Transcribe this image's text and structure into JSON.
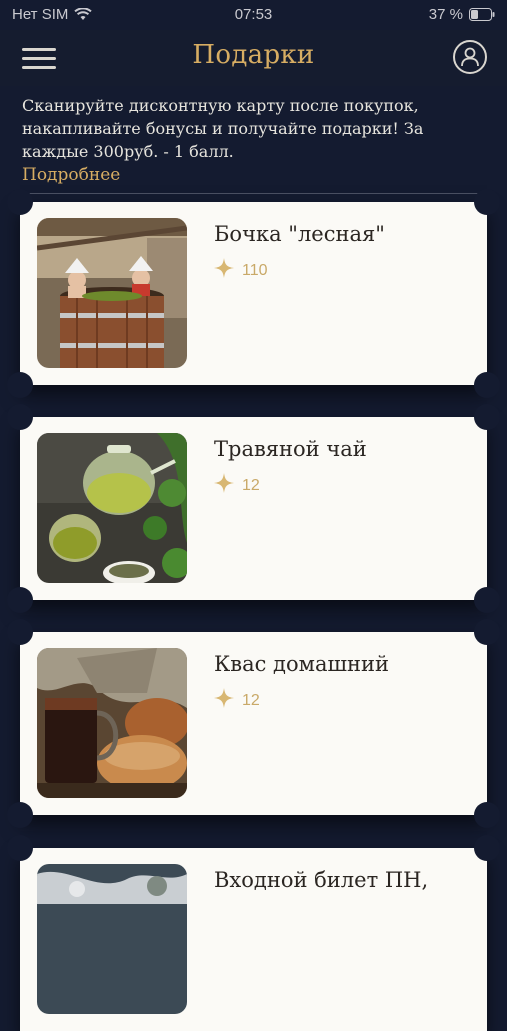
{
  "status": {
    "carrier": "Нет SIM",
    "time": "07:53",
    "battery": "37 %"
  },
  "nav": {
    "title": "Подарки"
  },
  "info": {
    "text": "Сканируйте дисконтную карту после покупок, накапливайте бонусы и получайте подарки! За каждые 300руб. - 1 балл.",
    "more": "Подробнее"
  },
  "gifts": [
    {
      "title": "Бочка \"лесная\"",
      "points": "110"
    },
    {
      "title": "Травяной чай",
      "points": "12"
    },
    {
      "title": "Квас домашний",
      "points": "12"
    },
    {
      "title": "Входной билет ПН,",
      "points": ""
    }
  ],
  "colors": {
    "background": "#141b30",
    "accent": "#d7ad63",
    "card": "#fbfaf6"
  }
}
